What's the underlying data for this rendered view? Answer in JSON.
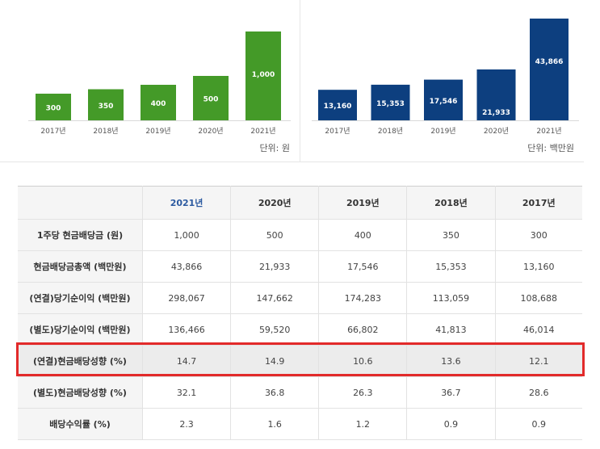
{
  "colors": {
    "green": "#449a28",
    "blue": "#0d3f7f"
  },
  "chart_data": [
    {
      "type": "bar",
      "categories": [
        "2017년",
        "2018년",
        "2019년",
        "2020년",
        "2021년"
      ],
      "values": [
        300,
        350,
        400,
        500,
        1000
      ],
      "value_labels": [
        "300",
        "350",
        "400",
        "500",
        "1,000"
      ],
      "unit": "단위: 원",
      "ylim": [
        0,
        1000
      ]
    },
    {
      "type": "bar",
      "categories": [
        "2017년",
        "2018년",
        "2019년",
        "2020년",
        "2021년"
      ],
      "values": [
        13160,
        15353,
        17546,
        21933,
        43866
      ],
      "value_labels": [
        "13,160",
        "15,353",
        "17,546",
        "21,933",
        "43,866"
      ],
      "unit": "단위: 백만원",
      "ylim": [
        0,
        43866
      ]
    }
  ],
  "table": {
    "headers": [
      "",
      "2021년",
      "2020년",
      "2019년",
      "2018년",
      "2017년"
    ],
    "rows": [
      {
        "label": "1주당 현금배당금 (원)",
        "values": [
          "1,000",
          "500",
          "400",
          "350",
          "300"
        ]
      },
      {
        "label": "현금배당금총액 (백만원)",
        "values": [
          "43,866",
          "21,933",
          "17,546",
          "15,353",
          "13,160"
        ]
      },
      {
        "label": "(연결)당기순이익 (백만원)",
        "values": [
          "298,067",
          "147,662",
          "174,283",
          "113,059",
          "108,688"
        ]
      },
      {
        "label": "(별도)당기순이익 (백만원)",
        "values": [
          "136,466",
          "59,520",
          "66,802",
          "41,813",
          "46,014"
        ]
      },
      {
        "label": "(연결)현금배당성향 (%)",
        "values": [
          "14.7",
          "14.9",
          "10.6",
          "13.6",
          "12.1"
        ]
      },
      {
        "label": "(별도)현금배당성향 (%)",
        "values": [
          "32.1",
          "36.8",
          "26.3",
          "36.7",
          "28.6"
        ]
      },
      {
        "label": "배당수익률 (%)",
        "values": [
          "2.3",
          "1.6",
          "1.2",
          "0.9",
          "0.9"
        ]
      }
    ]
  }
}
